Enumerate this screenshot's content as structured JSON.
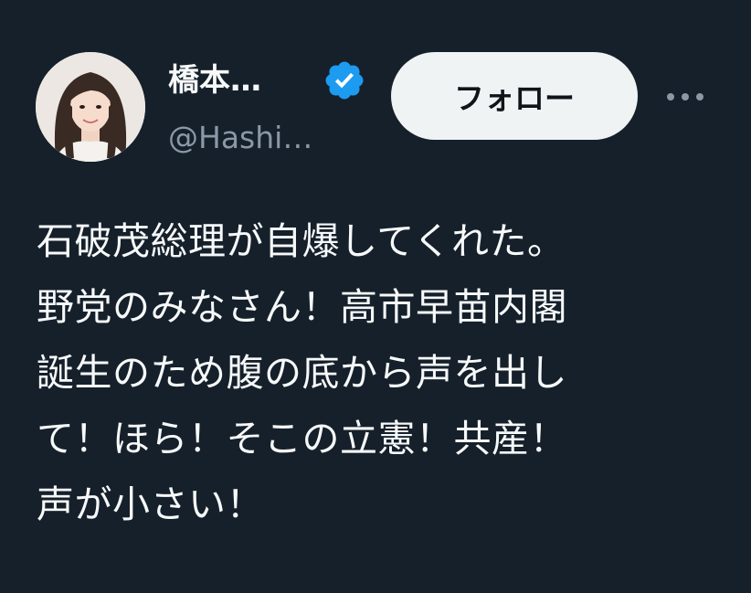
{
  "user": {
    "display_name": "橋本…",
    "handle": "@Hashi…",
    "verified": true,
    "avatar_icon": "profile-photo"
  },
  "actions": {
    "follow_label": "フォロー",
    "more_icon": "more-options-icon"
  },
  "tweet": {
    "lines": [
      "石破茂総理が自爆してくれた。",
      "野党のみなさん！高市早苗内閣",
      "誕生のため腹の底から声を出し",
      "て！ほら！そこの立憲！共産！",
      "声が小さい！"
    ]
  },
  "colors": {
    "background": "#15202b",
    "text": "#f7f9f9",
    "secondary_text": "#8b98a5",
    "verified_blue": "#1d9bf0",
    "follow_button_bg": "#eff3f4"
  }
}
